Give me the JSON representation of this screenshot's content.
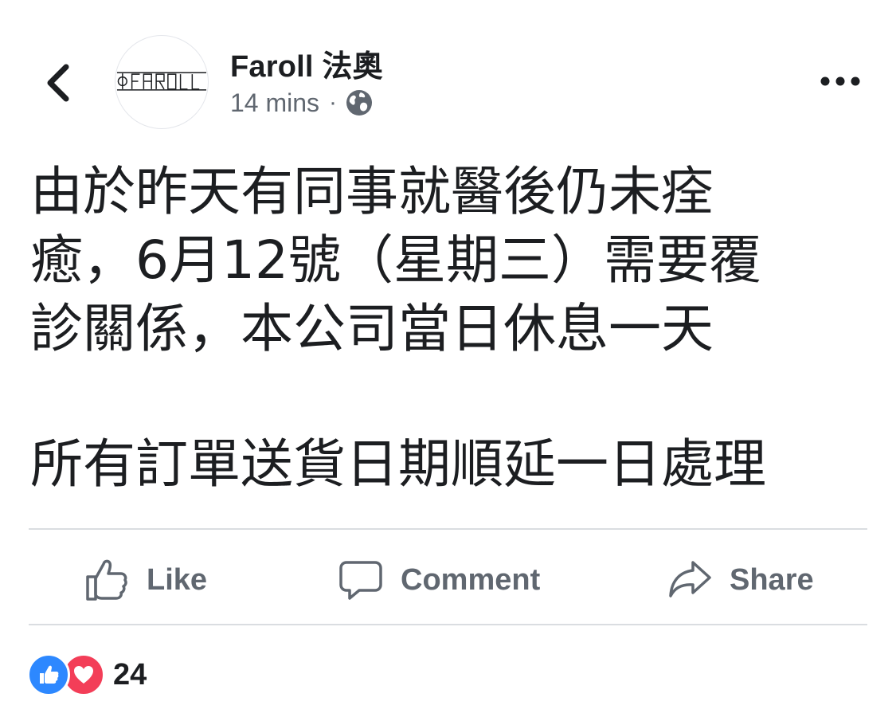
{
  "header": {
    "page_name": "Faroll 法奧",
    "avatar_logo_text": "ΦFAROLL",
    "timestamp": "14 mins",
    "separator": "·",
    "privacy_icon": "globe-icon",
    "back_icon": "chevron-left-icon",
    "more_icon": "more-horizontal-icon"
  },
  "post": {
    "lines": [
      "由於昨天有同事就醫後仍未痊",
      "癒，6月12號（星期三）需要覆",
      "診關係，本公司當日休息一天",
      "所有訂單送貨日期順延一日處理"
    ]
  },
  "actions": {
    "like_label": "Like",
    "comment_label": "Comment",
    "share_label": "Share"
  },
  "reactions": {
    "count": "24",
    "types": [
      "like-icon",
      "love-icon"
    ]
  },
  "colors": {
    "text_primary": "#1c1e21",
    "text_secondary": "#606770",
    "divider": "#dadde1",
    "like_blue": "#2d88ff",
    "love_red": "#f33e58"
  }
}
